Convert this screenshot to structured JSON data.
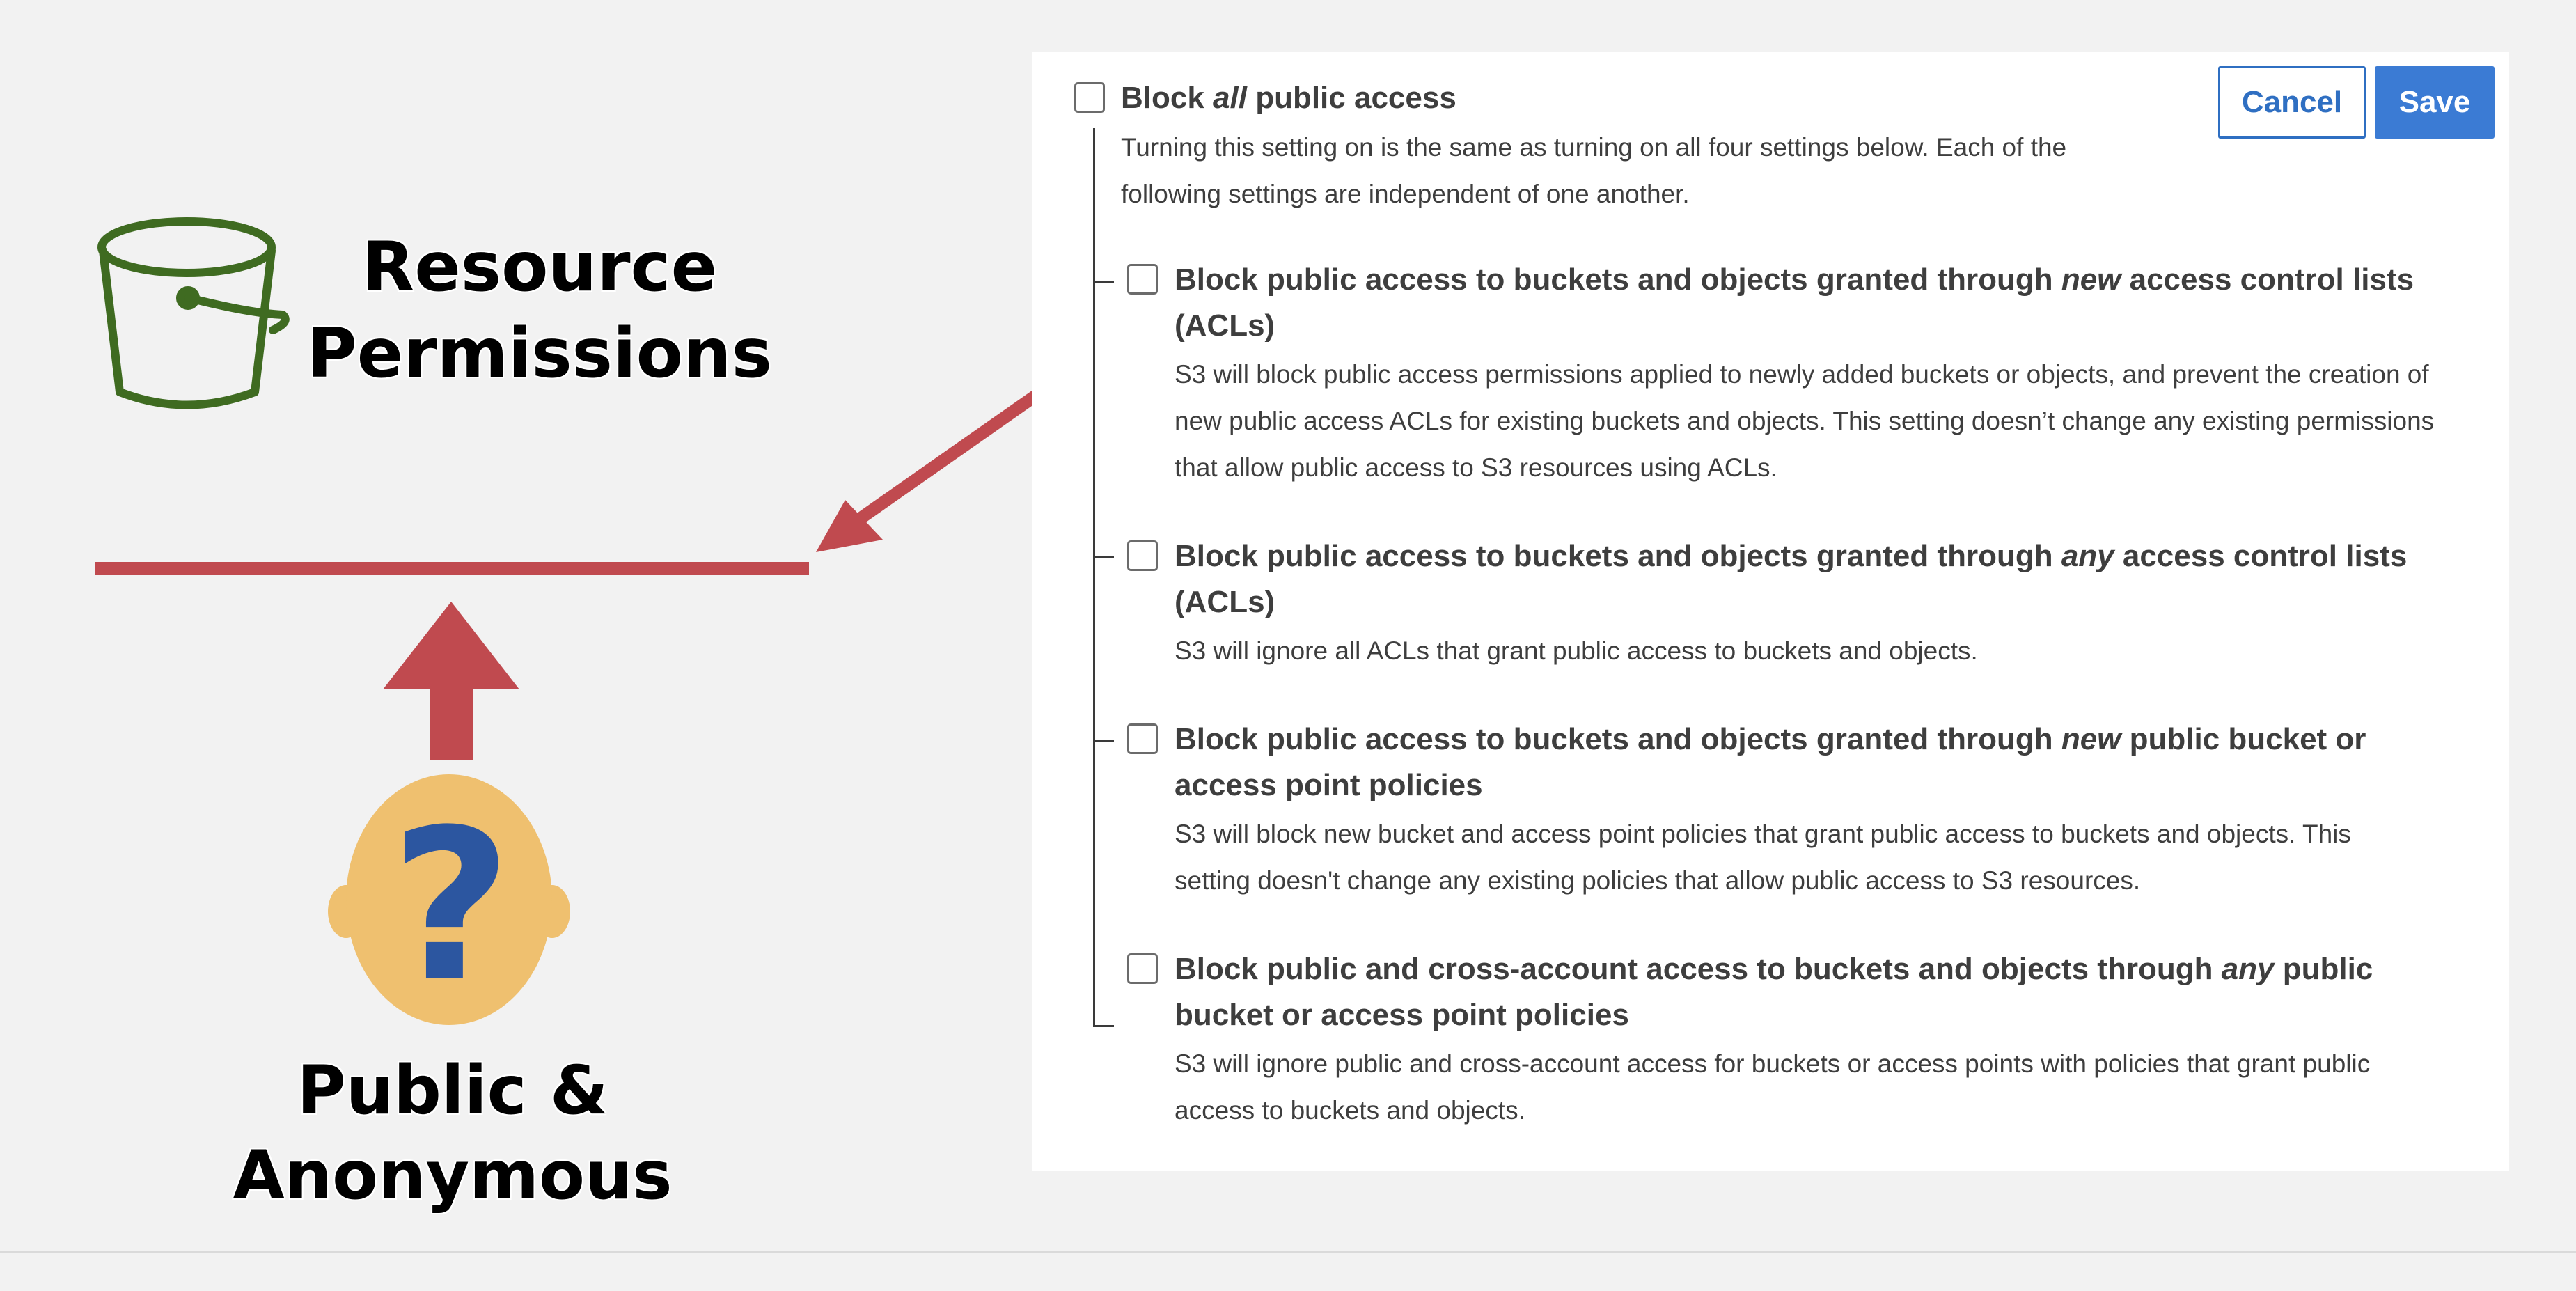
{
  "illustration": {
    "resource_title_line1": "Resource",
    "resource_title_line2": "Permissions",
    "public_title": "Public & Anonymous",
    "head_symbol": "?",
    "icons": [
      "bucket-icon",
      "person-question-icon",
      "arrow-up-icon",
      "arrow-diagonal-icon"
    ],
    "colors": {
      "bucket": "#3f6b21",
      "arrow": "#c04a4f",
      "head": "#efc06f",
      "question_mark": "#2c56a0"
    }
  },
  "panel": {
    "cancel_label": "Cancel",
    "save_label": "Save",
    "master": {
      "title_pre": "Block ",
      "title_em": "all",
      "title_post": " public access",
      "desc_line1": "Turning this setting on is the same as turning on all four settings below. Each of the",
      "desc_line2": "following settings are independent of one another."
    },
    "options": [
      {
        "title_pre": "Block public access to buckets and objects granted through ",
        "title_em": "new",
        "title_post": " access control lists",
        "title_line2": "(ACLs)",
        "desc_line1": "S3 will block public access permissions applied to newly added buckets or objects, and prevent the creation of",
        "desc_line2": "new public access ACLs for existing buckets and objects. This setting doesn’t change any existing permissions",
        "desc_line3": "that allow public access to S3 resources using ACLs."
      },
      {
        "title_pre": "Block public access to buckets and objects granted through ",
        "title_em": "any",
        "title_post": " access control lists",
        "title_line2": "(ACLs)",
        "desc_line1": "S3 will ignore all ACLs that grant public access to buckets and objects."
      },
      {
        "title_pre": "Block public access to buckets and objects granted through ",
        "title_em": "new",
        "title_post": " public bucket or",
        "title_line2": "access point policies",
        "desc_line1": "S3 will block new bucket and access point policies that grant public access to buckets and objects. This",
        "desc_line2": "setting doesn't change any existing policies that allow public access to S3 resources."
      },
      {
        "title_pre": "Block public and cross-account access to buckets and objects through ",
        "title_em": "any",
        "title_post": " public",
        "title_line2": "bucket or access point policies",
        "desc_line1": "S3 will ignore public and cross-account access for buckets or access points with policies that grant public",
        "desc_line2": "access to buckets and objects."
      }
    ]
  }
}
